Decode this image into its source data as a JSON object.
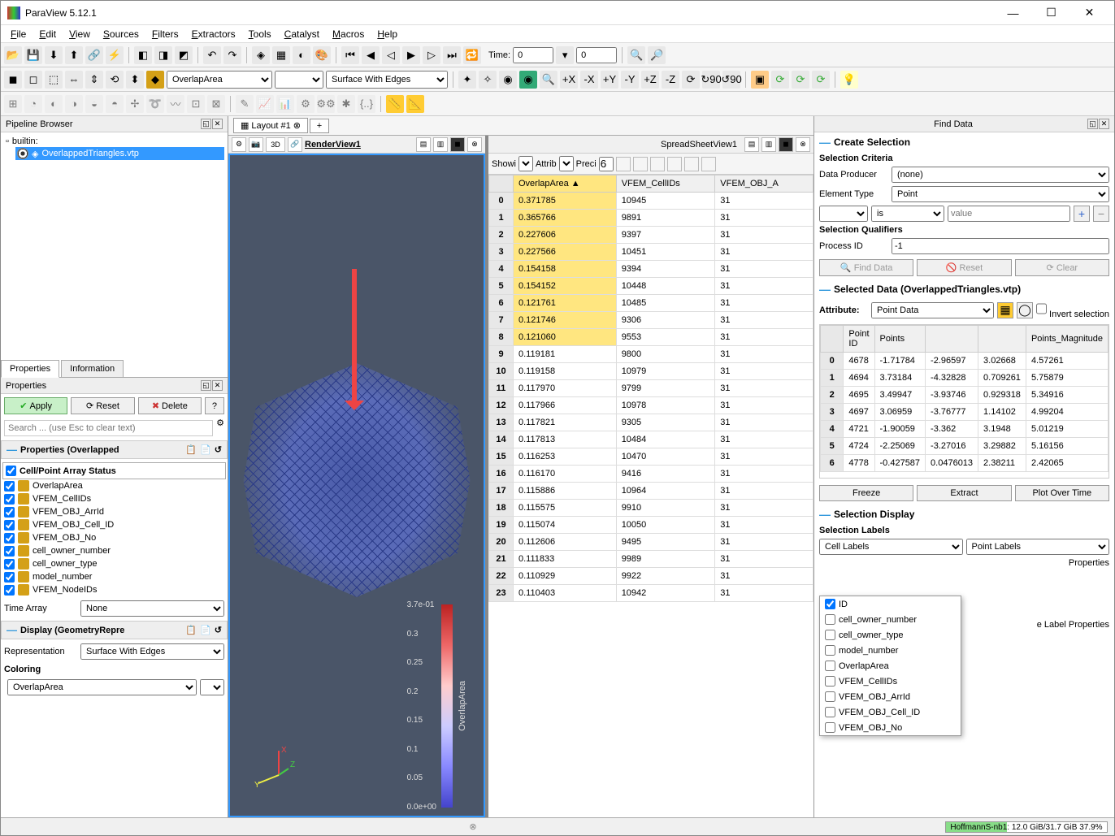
{
  "title": "ParaView 5.12.1",
  "menu": [
    "File",
    "Edit",
    "View",
    "Sources",
    "Filters",
    "Extractors",
    "Tools",
    "Catalyst",
    "Macros",
    "Help"
  ],
  "toolbar2": {
    "time_label": "Time:",
    "time_value": "0",
    "time_index": "0"
  },
  "toolbar3": {
    "color_by": "OverlapArea",
    "representation": "Surface With Edges"
  },
  "pipeline": {
    "title": "Pipeline Browser",
    "root": "builtin:",
    "items": [
      "OverlappedTriangles.vtp"
    ]
  },
  "tabs": {
    "props": "Properties",
    "info": "Information"
  },
  "props": {
    "title": "Properties",
    "apply": "Apply",
    "reset": "Reset",
    "delete": "Delete",
    "search_placeholder": "Search ... (use Esc to clear text)",
    "section_props": "Properties (Overlapped",
    "cell_point_status": "Cell/Point Array Status",
    "arrays": [
      "OverlapArea",
      "VFEM_CellIDs",
      "VFEM_OBJ_ArrId",
      "VFEM_OBJ_Cell_ID",
      "VFEM_OBJ_No",
      "cell_owner_number",
      "cell_owner_type",
      "model_number",
      "VFEM_NodeIDs"
    ],
    "time_array_label": "Time Array",
    "time_array_value": "None",
    "section_display": "Display (GeometryRepre",
    "repr_label": "Representation",
    "repr_value": "Surface With Edges",
    "coloring_label": "Coloring",
    "coloring_value": "OverlapArea"
  },
  "layout": {
    "tab": "Layout #1"
  },
  "render_view": {
    "name": "RenderView1",
    "btn_3d": "3D",
    "colorbar_title": "OverlapArea",
    "colorbar_ticks": [
      "3.7e-01",
      "0.3",
      "0.25",
      "0.2",
      "0.15",
      "0.1",
      "0.05",
      "0.0e+00"
    ]
  },
  "spreadsheet": {
    "name": "SpreadSheetView1",
    "showing_label": "Showi",
    "attribute_label": "Attrib",
    "precision_label": "Preci",
    "precision": "6",
    "cols": [
      "",
      "OverlapArea",
      "VFEM_CellIDs",
      "VFEM_OBJ_A"
    ],
    "rows": [
      [
        "0",
        "0.371785",
        "10945",
        "31"
      ],
      [
        "1",
        "0.365766",
        "9891",
        "31"
      ],
      [
        "2",
        "0.227606",
        "9397",
        "31"
      ],
      [
        "3",
        "0.227566",
        "10451",
        "31"
      ],
      [
        "4",
        "0.154158",
        "9394",
        "31"
      ],
      [
        "5",
        "0.154152",
        "10448",
        "31"
      ],
      [
        "6",
        "0.121761",
        "10485",
        "31"
      ],
      [
        "7",
        "0.121746",
        "9306",
        "31"
      ],
      [
        "8",
        "0.121060",
        "9553",
        "31"
      ],
      [
        "9",
        "0.119181",
        "9800",
        "31"
      ],
      [
        "10",
        "0.119158",
        "10979",
        "31"
      ],
      [
        "11",
        "0.117970",
        "9799",
        "31"
      ],
      [
        "12",
        "0.117966",
        "10978",
        "31"
      ],
      [
        "13",
        "0.117821",
        "9305",
        "31"
      ],
      [
        "14",
        "0.117813",
        "10484",
        "31"
      ],
      [
        "15",
        "0.116253",
        "10470",
        "31"
      ],
      [
        "16",
        "0.116170",
        "9416",
        "31"
      ],
      [
        "17",
        "0.115886",
        "10964",
        "31"
      ],
      [
        "18",
        "0.115575",
        "9910",
        "31"
      ],
      [
        "19",
        "0.115074",
        "10050",
        "31"
      ],
      [
        "20",
        "0.112606",
        "9495",
        "31"
      ],
      [
        "21",
        "0.111833",
        "9989",
        "31"
      ],
      [
        "22",
        "0.110929",
        "9922",
        "31"
      ],
      [
        "23",
        "0.110403",
        "10942",
        "31"
      ]
    ]
  },
  "find_data": {
    "title": "Find Data",
    "create_selection": "Create Selection",
    "criteria": "Selection Criteria",
    "data_producer": "Data Producer",
    "data_producer_val": "(none)",
    "element_type": "Element Type",
    "element_type_val": "Point",
    "op": "is",
    "value_ph": "value",
    "qualifiers": "Selection Qualifiers",
    "process_id": "Process ID",
    "process_id_val": "-1",
    "find": "Find Data",
    "reset": "Reset",
    "clear": "Clear",
    "selected_data": "Selected Data (OverlappedTriangles.vtp)",
    "attribute": "Attribute:",
    "attribute_val": "Point Data",
    "invert": "Invert selection",
    "cols": [
      "",
      "Point ID",
      "Points",
      "",
      "",
      "Points_Magnitude"
    ],
    "rows": [
      [
        "0",
        "4678",
        "-1.71784",
        "-2.96597",
        "3.02668",
        "4.57261"
      ],
      [
        "1",
        "4694",
        "3.73184",
        "-4.32828",
        "0.709261",
        "5.75879"
      ],
      [
        "2",
        "4695",
        "3.49947",
        "-3.93746",
        "0.929318",
        "5.34916"
      ],
      [
        "3",
        "4697",
        "3.06959",
        "-3.76777",
        "1.14102",
        "4.99204"
      ],
      [
        "4",
        "4721",
        "-1.90059",
        "-3.362",
        "3.1948",
        "5.01219"
      ],
      [
        "5",
        "4724",
        "-2.25069",
        "-3.27016",
        "3.29882",
        "5.16156"
      ],
      [
        "6",
        "4778",
        "-0.427587",
        "0.0476013",
        "2.38211",
        "2.42065"
      ]
    ],
    "freeze": "Freeze",
    "extract": "Extract",
    "plot": "Plot Over Time",
    "sel_display": "Selection Display",
    "sel_labels": "Selection Labels",
    "cell_labels_btn": "Cell Labels",
    "point_labels_btn": "Point Labels",
    "interactive_props": "Properties",
    "label_props": "e Label Properties",
    "dd_items": [
      {
        "label": "ID",
        "checked": true
      },
      {
        "label": "cell_owner_number",
        "checked": false
      },
      {
        "label": "cell_owner_type",
        "checked": false
      },
      {
        "label": "model_number",
        "checked": false
      },
      {
        "label": "OverlapArea",
        "checked": false
      },
      {
        "label": "VFEM_CellIDs",
        "checked": false
      },
      {
        "label": "VFEM_OBJ_ArrId",
        "checked": false
      },
      {
        "label": "VFEM_OBJ_Cell_ID",
        "checked": false
      },
      {
        "label": "VFEM_OBJ_No",
        "checked": false
      }
    ]
  },
  "status": {
    "text": "HoffmannS-nb1: 12.0 GiB/31.7 GiB 37.9%"
  }
}
